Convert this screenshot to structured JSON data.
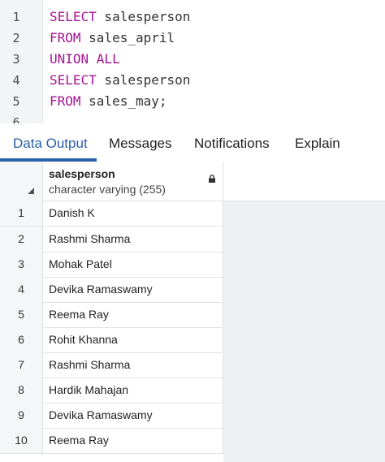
{
  "editor": {
    "lines": [
      {
        "num": "1",
        "kw": "SELECT",
        "rest": " salesperson"
      },
      {
        "num": "2",
        "kw": "FROM",
        "rest": " sales_april"
      },
      {
        "num": "3",
        "kw": "UNION ALL",
        "rest": ""
      },
      {
        "num": "4",
        "kw": "SELECT",
        "rest": " salesperson"
      },
      {
        "num": "5",
        "kw": "FROM",
        "rest": " sales_may;"
      },
      {
        "num": "6",
        "kw": "",
        "rest": ""
      }
    ]
  },
  "tabs": {
    "data_output": "Data Output",
    "messages": "Messages",
    "notifications": "Notifications",
    "explain": "Explain"
  },
  "grid": {
    "column": {
      "name": "salesperson",
      "type": "character varying (255)"
    },
    "rows": [
      {
        "num": "1",
        "value": "Danish K"
      },
      {
        "num": "2",
        "value": "Rashmi Sharma"
      },
      {
        "num": "3",
        "value": "Mohak Patel"
      },
      {
        "num": "4",
        "value": "Devika Ramaswamy"
      },
      {
        "num": "5",
        "value": "Reema Ray"
      },
      {
        "num": "6",
        "value": "Rohit Khanna"
      },
      {
        "num": "7",
        "value": "Rashmi Sharma"
      },
      {
        "num": "8",
        "value": "Hardik Mahajan"
      },
      {
        "num": "9",
        "value": "Devika Ramaswamy"
      },
      {
        "num": "10",
        "value": "Reema Ray"
      }
    ]
  },
  "colors": {
    "keyword": "#a1158f",
    "active_tab": "#2b5fa8"
  },
  "icons": {
    "lock": "lock-icon",
    "sort": "corner-triangle-icon"
  }
}
